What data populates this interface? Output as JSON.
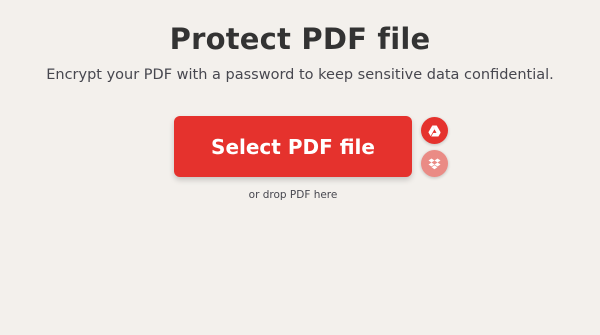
{
  "page": {
    "title": "Protect PDF file",
    "subtitle": "Encrypt your PDF with a password to keep sensitive data confidential."
  },
  "upload": {
    "select_label": "Select PDF file",
    "drop_hint": "or drop PDF here",
    "sources": [
      {
        "icon": "google-drive-icon"
      },
      {
        "icon": "dropbox-icon"
      }
    ]
  },
  "colors": {
    "background": "#f3f0ec",
    "accent": "#e5322d",
    "accent_light": "#ea8b85",
    "text_dark": "#333333",
    "text_muted": "#47474f"
  }
}
